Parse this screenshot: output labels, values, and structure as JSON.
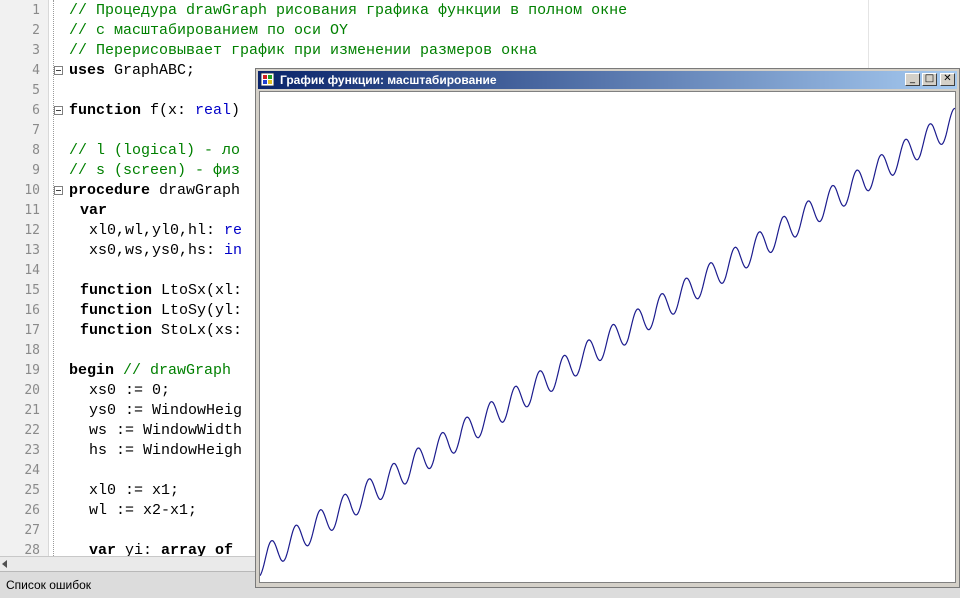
{
  "editor": {
    "lines": [
      {
        "n": "1",
        "indent": 0,
        "parts": [
          {
            "t": "// Процедура drawGraph рисования графика функции в полном окне",
            "s": "cm"
          }
        ]
      },
      {
        "n": "2",
        "indent": 0,
        "parts": [
          {
            "t": "// с масштабированием по оси OY",
            "s": "cm"
          }
        ]
      },
      {
        "n": "3",
        "indent": 0,
        "parts": [
          {
            "t": "// Перерисовывает график при изменении размеров окна",
            "s": "cm"
          }
        ]
      },
      {
        "n": "4",
        "indent": 0,
        "fold": true,
        "parts": [
          {
            "t": "uses",
            "s": "kw"
          },
          {
            "t": " GraphABC;",
            "s": ""
          }
        ]
      },
      {
        "n": "5",
        "indent": 0,
        "parts": []
      },
      {
        "n": "6",
        "indent": 0,
        "fold": true,
        "parts": [
          {
            "t": "function",
            "s": "kw"
          },
          {
            "t": " f(x: ",
            "s": ""
          },
          {
            "t": "real",
            "s": "ty"
          },
          {
            "t": ")",
            "s": ""
          }
        ]
      },
      {
        "n": "7",
        "indent": 0,
        "parts": []
      },
      {
        "n": "8",
        "indent": 0,
        "parts": [
          {
            "t": "// l (logical) - ло",
            "s": "cm"
          }
        ]
      },
      {
        "n": "9",
        "indent": 0,
        "parts": [
          {
            "t": "// s (screen) - физ",
            "s": "cm"
          }
        ]
      },
      {
        "n": "10",
        "indent": 0,
        "fold": true,
        "parts": [
          {
            "t": "procedure",
            "s": "kw"
          },
          {
            "t": " drawGraph",
            "s": ""
          }
        ]
      },
      {
        "n": "11",
        "indent": 1,
        "parts": [
          {
            "t": "var",
            "s": "kw"
          }
        ]
      },
      {
        "n": "12",
        "indent": 1,
        "parts": [
          {
            "t": " xl0,wl,yl0,hl: ",
            "s": ""
          },
          {
            "t": "re",
            "s": "ty"
          }
        ]
      },
      {
        "n": "13",
        "indent": 1,
        "parts": [
          {
            "t": " xs0,ws,ys0,hs: ",
            "s": ""
          },
          {
            "t": "in",
            "s": "ty"
          }
        ]
      },
      {
        "n": "14",
        "indent": 0,
        "parts": []
      },
      {
        "n": "15",
        "indent": 1,
        "parts": [
          {
            "t": "function",
            "s": "kw"
          },
          {
            "t": " LtoSx(xl:",
            "s": ""
          }
        ]
      },
      {
        "n": "16",
        "indent": 1,
        "parts": [
          {
            "t": "function",
            "s": "kw"
          },
          {
            "t": " LtoSy(yl:",
            "s": ""
          }
        ]
      },
      {
        "n": "17",
        "indent": 1,
        "parts": [
          {
            "t": "function",
            "s": "kw"
          },
          {
            "t": " StoLx(xs:",
            "s": ""
          }
        ]
      },
      {
        "n": "18",
        "indent": 0,
        "parts": []
      },
      {
        "n": "19",
        "indent": 0,
        "parts": [
          {
            "t": "begin",
            "s": "kw"
          },
          {
            "t": " // drawGraph",
            "s": "cm"
          }
        ]
      },
      {
        "n": "20",
        "indent": 2,
        "parts": [
          {
            "t": "xs0 := 0;",
            "s": ""
          }
        ]
      },
      {
        "n": "21",
        "indent": 2,
        "parts": [
          {
            "t": "ys0 := WindowHeig",
            "s": ""
          }
        ]
      },
      {
        "n": "22",
        "indent": 2,
        "parts": [
          {
            "t": "ws := WindowWidth",
            "s": ""
          }
        ]
      },
      {
        "n": "23",
        "indent": 2,
        "parts": [
          {
            "t": "hs := WindowHeigh",
            "s": ""
          }
        ]
      },
      {
        "n": "24",
        "indent": 0,
        "parts": []
      },
      {
        "n": "25",
        "indent": 2,
        "parts": [
          {
            "t": "xl0 := x1;",
            "s": ""
          }
        ]
      },
      {
        "n": "26",
        "indent": 2,
        "parts": [
          {
            "t": "wl := x2-x1;",
            "s": ""
          }
        ]
      },
      {
        "n": "27",
        "indent": 0,
        "parts": []
      },
      {
        "n": "28",
        "indent": 2,
        "parts": [
          {
            "t": "var",
            "s": "kw"
          },
          {
            "t": " yi: ",
            "s": ""
          },
          {
            "t": "array",
            "s": "kw"
          },
          {
            "t": " of",
            "s": "kw"
          }
        ]
      }
    ]
  },
  "status": {
    "text": "Список ошибок"
  },
  "graph_window": {
    "title": "График функции: масштабирование",
    "buttons": {
      "minimize": "_",
      "maximize": "□",
      "close": "✕"
    }
  },
  "colors": {
    "curve": "#1c1c8e",
    "comment": "#008000",
    "type": "#0000c8",
    "titlebar": "#0a246a"
  },
  "icons": [
    "app-icon",
    "minimize-icon",
    "maximize-icon",
    "close-icon",
    "fold-icon",
    "scroll-left-arrow-icon"
  ]
}
